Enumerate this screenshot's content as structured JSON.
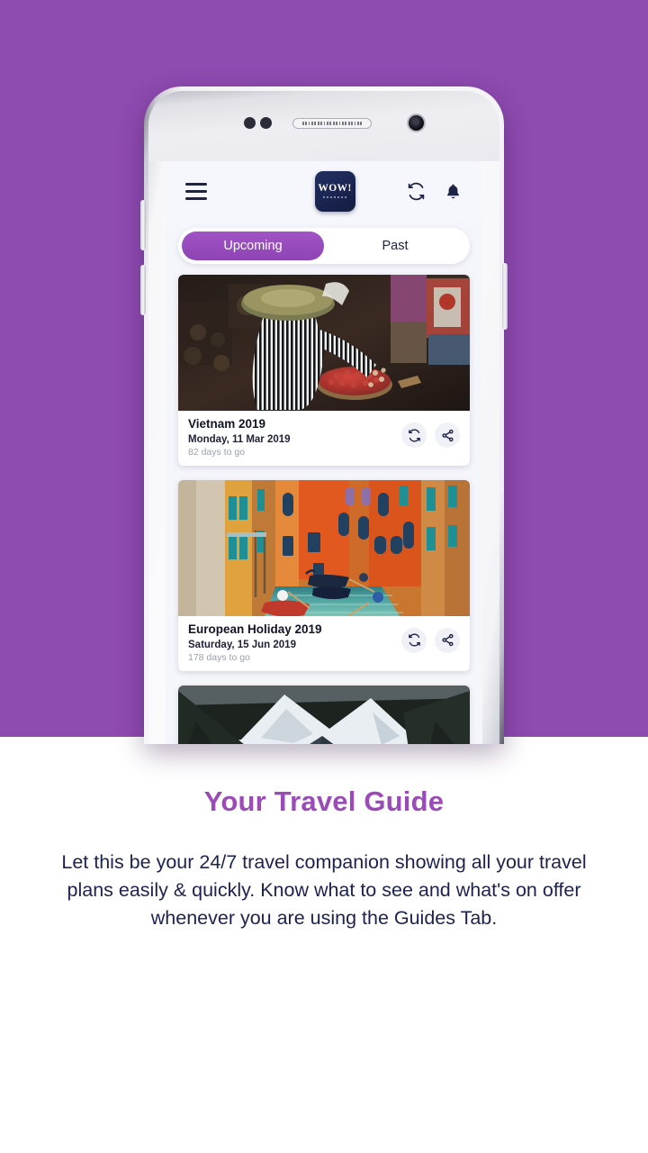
{
  "theme": {
    "hero_background": "#8e4bb0",
    "accent_purple": "#9a4bb8",
    "tab_active": "#8e44b3",
    "text_navy": "#1c2250",
    "logo_navy": "#1a2450"
  },
  "phone": {
    "hardware": {
      "sensor_left": "proximity-sensor",
      "sensor_right": "light-sensor",
      "speaker": "earpiece-speaker",
      "camera": "front-camera",
      "volume_up": "volume-up-button",
      "volume_down": "volume-down-button",
      "power": "power-button"
    }
  },
  "app": {
    "appbar": {
      "menu_icon": "hamburger-menu-icon",
      "logo_text": "WOW!",
      "refresh_icon": "refresh-icon",
      "notifications_icon": "bell-icon"
    },
    "tabs": [
      {
        "label": "Upcoming",
        "active": true
      },
      {
        "label": "Past",
        "active": false
      }
    ],
    "trips": [
      {
        "title": "Vietnam 2019",
        "date": "Monday, 11 Mar 2019",
        "countdown": "82 days to go",
        "photo": "vietnam-market-vendor",
        "sync_icon": "refresh-icon",
        "share_icon": "share-icon"
      },
      {
        "title": "European Holiday 2019",
        "date": "Saturday, 15 Jun 2019",
        "countdown": "178 days to go",
        "photo": "venice-canal-gondolas",
        "sync_icon": "refresh-icon",
        "share_icon": "share-icon"
      },
      {
        "title": "",
        "date": "",
        "countdown": "",
        "photo": "snow-mountains",
        "sync_icon": "refresh-icon",
        "share_icon": "share-icon"
      }
    ]
  },
  "caption": {
    "heading": "Your Travel Guide",
    "body": "Let this be your 24/7 travel companion showing all your travel plans easily & quickly. Know what to see and what's on offer whenever you are using the Guides Tab."
  }
}
